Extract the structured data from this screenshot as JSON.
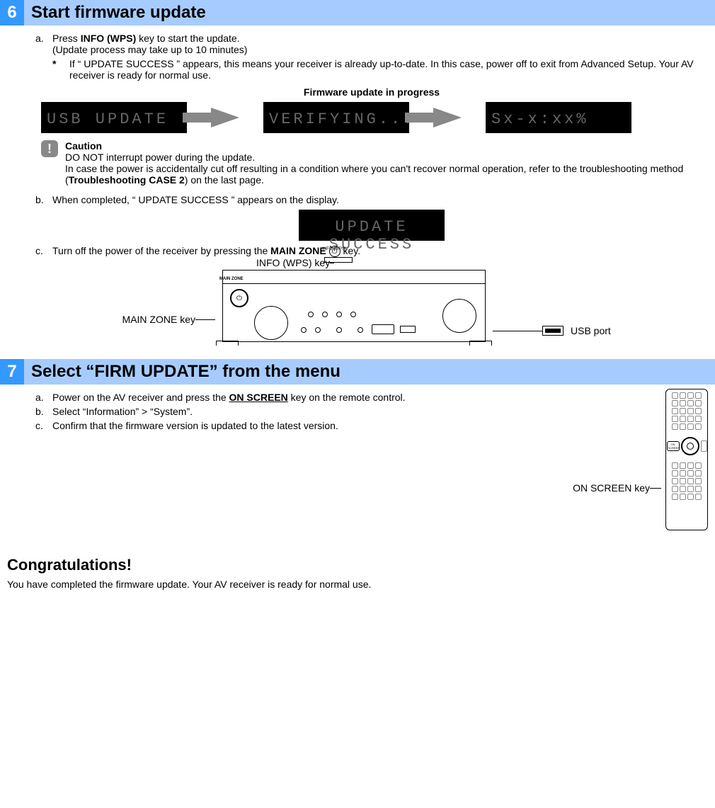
{
  "step6": {
    "num": "6",
    "title": "Start firmware update",
    "a_marker": "a.",
    "a_text_pre": "Press ",
    "a_key": "INFO (WPS)",
    "a_text_post": " key to start the update.",
    "a_sub": "(Update process may take up to 10 minutes)",
    "star": "*",
    "star_text": "If “ UPDATE SUCCESS ” appears, this means your receiver is already up-to-date. In this case, power off to exit from Advanced Setup. Your AV receiver is ready for normal use.",
    "progress_caption": "Firmware update in progress",
    "lcd1": "USB UPDATE",
    "lcd2": "VERIFYING...",
    "lcd3": "Sx-x:xx%",
    "caution_title": "Caution",
    "caution_line1": "DO NOT interrupt power during the update.",
    "caution_line2_pre": "In case the power is accidentally cut off resulting in a condition where you can't recover normal operation, refer to the troubleshooting method (",
    "caution_ref": "Troubleshooting CASE 2",
    "caution_line2_post": ") on the last page.",
    "b_marker": "b.",
    "b_text": "When completed, “ UPDATE SUCCESS ” appears on the display.",
    "lcd_success": "UPDATE SUCCESS",
    "c_marker": "c.",
    "c_text_pre": "Turn off the power of the receiver by pressing the ",
    "c_key": "MAIN ZONE",
    "c_text_post": " key.",
    "diag_info_label": "INFO (WPS) key",
    "diag_mainzone_label": "MAIN ZONE    key",
    "diag_usb_label": "USB port",
    "diag_mainzone_small": "MAIN ZONE",
    "diag_info_small": "INFO (WPS)",
    "power_glyph": "⏻"
  },
  "step7": {
    "num": "7",
    "title": "Select “FIRM UPDATE” from the menu",
    "a_marker": "a.",
    "a_text_pre": "Power on the AV receiver and press the ",
    "a_key": "ON SCREEN",
    "a_text_post": " key on the remote control.",
    "b_marker": "b.",
    "b_text": "Select “Information” > “System”.",
    "c_marker": "c.",
    "c_text": "Confirm that the firmware version is updated to the latest version.",
    "remote_label": "ON SCREEN key",
    "remote_btn": "ON SCREEN"
  },
  "congrats": {
    "title": "Congratulations!",
    "text": "You have completed the firmware update. Your AV receiver is ready for normal use."
  }
}
